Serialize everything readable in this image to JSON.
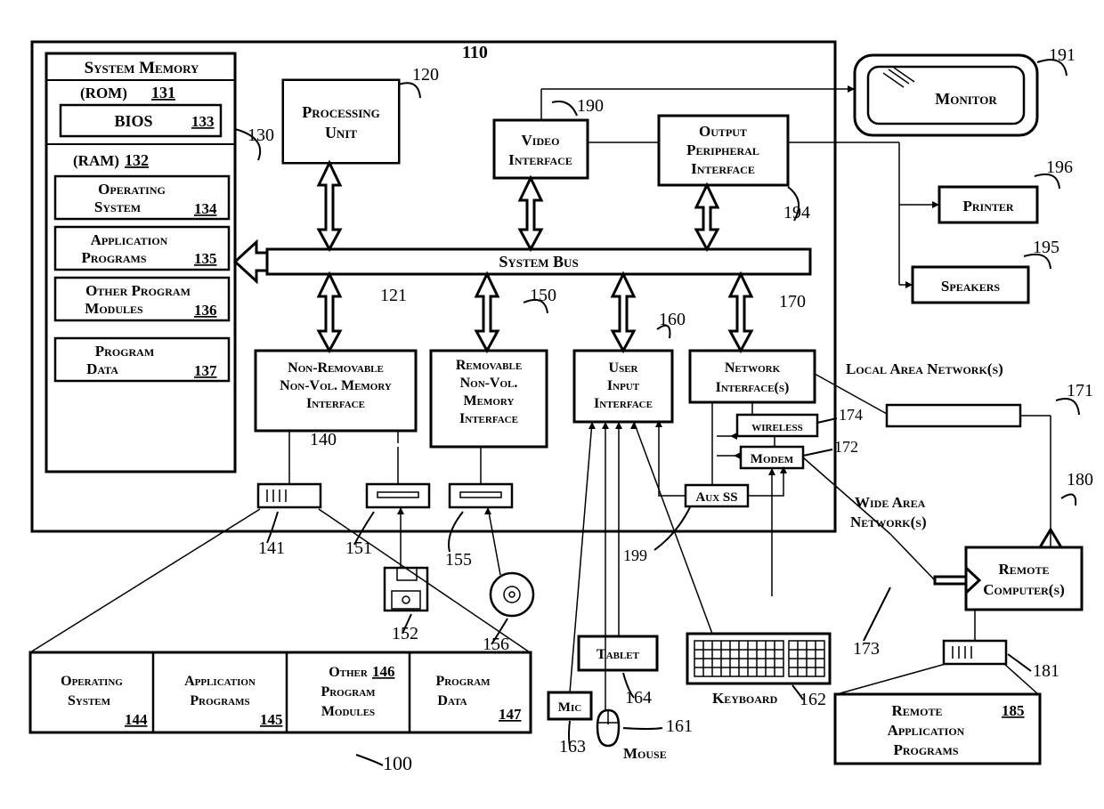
{
  "refs": {
    "fig": "100",
    "system": "110",
    "processing": "120",
    "systemBus": "121",
    "sysMemCallout": "130",
    "rom": "131",
    "ram": "132",
    "bios": "133",
    "os_ram": "134",
    "apps_ram": "135",
    "opm_ram": "136",
    "pdata_ram": "137",
    "nrnv_if": "140",
    "hdd": "141",
    "os_hdd": "144",
    "apps_hdd": "145",
    "opm_hdd": "146",
    "pdata_hdd": "147",
    "rnv_if": "150",
    "floppy_drive": "151",
    "floppy_disk": "152",
    "cd_drive": "155",
    "cd_disk": "156",
    "user_if": "160",
    "mouse": "161",
    "keyboard": "162",
    "mic": "163",
    "tablet": "164",
    "net_if": "170",
    "lan": "171",
    "modem": "172",
    "wan": "173",
    "wireless": "174",
    "remote_comp": "180",
    "remote_hdd": "181",
    "remote_apps": "185",
    "video_if": "190",
    "monitor": "191",
    "out_if": "194",
    "speakers": "195",
    "printer": "196",
    "auxss": "199"
  },
  "labels": {
    "sysMemHeading": "System Memory",
    "rom": "(ROM)",
    "ram": "(RAM)",
    "bios": "BIOS",
    "os": "Operating System",
    "apps": "Application Programs",
    "opm": "Other Program Modules",
    "pdata": "Program Data",
    "processing": "Processing Unit",
    "sysBus": "System Bus",
    "video_if": "Video Interface",
    "out_if": "Output Peripheral Interface",
    "nrnv_if_l1": "Non-Removable",
    "nrnv_if_l2": "Non-Vol. Memory",
    "nrnv_if_l3": "Interface",
    "rnv_if_l1": "Removable",
    "rnv_if_l2": "Non-Vol.",
    "rnv_if_l3": "Memory",
    "rnv_if_l4": "Interface",
    "user_if_l1": "User",
    "user_if_l2": "Input",
    "user_if_l3": "Interface",
    "net_if_l1": "Network",
    "net_if_l2": "Interface(s)",
    "wireless": "wireless",
    "modem": "Modem",
    "auxss": "Aux SS",
    "monitor": "Monitor",
    "printer": "Printer",
    "speakers": "Speakers",
    "lan": "Local Area Network(s)",
    "wan_l1": "Wide Area",
    "wan_l2": "Network(s)",
    "remote_l1": "Remote",
    "remote_l2": "Computer(s)",
    "remote_apps_l1": "Remote",
    "remote_apps_l2": "Application",
    "remote_apps_l3": "Programs",
    "tablet": "Tablet",
    "keyboard": "Keyboard",
    "mic": "Mic",
    "mouse": "Mouse"
  }
}
